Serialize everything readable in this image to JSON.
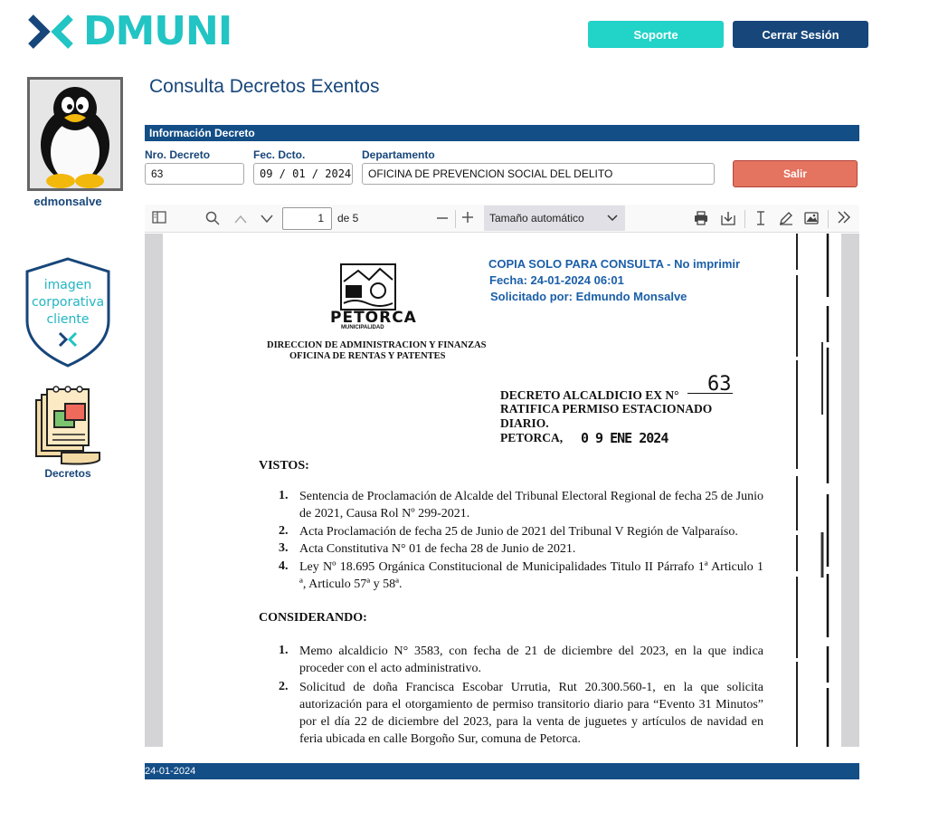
{
  "brand": {
    "name": "DMUNI"
  },
  "header": {
    "support_label": "Soporte",
    "logout_label": "Cerrar Sesión"
  },
  "user": {
    "username": "edmonsalve"
  },
  "sidebar": {
    "corp_image_lines": [
      "imagen",
      "corporativa",
      "cliente"
    ],
    "decretos_label": "Decretos"
  },
  "page": {
    "title": "Consulta Decretos Exentos"
  },
  "form": {
    "section_title": "Información Decreto",
    "nro_label": "Nro. Decreto",
    "nro_value": "63",
    "fecha_label": "Fec. Dcto.",
    "fecha_value": "09 / 01 / 2024",
    "depto_label": "Departamento",
    "depto_value": "OFICINA DE PREVENCION SOCIAL DEL DELITO",
    "exit_label": "Salir"
  },
  "pdf_toolbar": {
    "page_current": "1",
    "page_of": "de 5",
    "zoom": "Tamaño automático"
  },
  "document": {
    "stamp_lines": [
      "COPIA SOLO PARA CONSULTA - No imprimir",
      "Fecha: 24-01-2024 06:01",
      "Solicitado por: Edmundo Monsalve"
    ],
    "muni_name": "PETORCA",
    "muni_sub": "MUNICIPALIDAD",
    "dept_line1": "DIRECCION DE ADMINISTRACION Y FINANZAS",
    "dept_line2": "OFICINA DE RENTAS Y PATENTES",
    "decree_title": "DECRETO ALCALDICIO EX N°",
    "decree_number": "63",
    "decree_subject1": "RATIFICA PERMISO ESTACIONADO",
    "decree_subject2": "DIARIO.",
    "place": "PETORCA,",
    "date_stamp": "0 9 ENE 2024",
    "vistos_heading": "VISTOS:",
    "vistos": [
      "Sentencia de Proclamación de Alcalde del Tribunal Electoral Regional de fecha 25 de Junio de 2021, Causa Rol Nº 299-2021.",
      "Acta Proclamación de fecha 25 de Junio de 2021 del Tribunal V Región de Valparaíso.",
      "Acta Constitutiva N° 01 de fecha 28 de Junio de 2021.",
      "Ley Nº 18.695 Orgánica Constitucional de Municipalidades Titulo II Párrafo 1ª Articulo 1 ª, Articulo 57ª y 58ª."
    ],
    "considerando_heading": "CONSIDERANDO:",
    "considerando": [
      "Memo alcaldicio N° 3583, con fecha de 21 de diciembre del 2023, en la que indica proceder con el acto administrativo.",
      "Solicitud de doña Francisca Escobar Urrutia, Rut 20.300.560-1, en la que solicita autorización para el otorgamiento de permiso transitorio diario para “Evento 31 Minutos” por el día 22 de diciembre del 2023, para la venta de juguetes y artículos de navidad en feria ubicada en calle Borgoño Sur, comuna de Petorca."
    ]
  },
  "footer": {
    "date": "24-01-2024"
  }
}
